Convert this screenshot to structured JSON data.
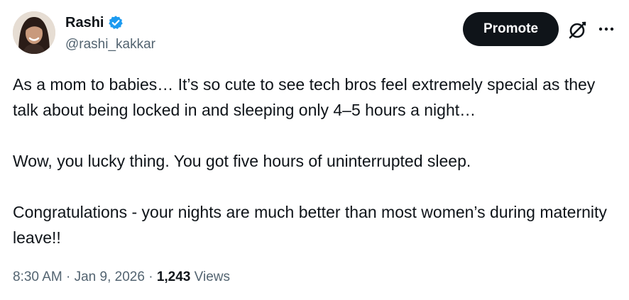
{
  "author": {
    "display_name": "Rashi",
    "handle": "@rashi_kakkar",
    "verified": true
  },
  "actions": {
    "promote_label": "Promote",
    "grok_icon": "grok-icon",
    "more_icon": "more-icon"
  },
  "tweet": {
    "paragraphs": [
      "As a mom to babies… It’s so cute to see tech bros feel extremely special as they talk about being locked in and sleeping only 4–5 hours a night…",
      "Wow, you lucky thing. You got five hours of uninterrupted sleep.",
      "Congratulations - your nights are much better than most women’s during maternity leave!!"
    ],
    "time": "8:30 AM",
    "separator": "·",
    "date": "Jan 9, 2026",
    "views_count": "1,243",
    "views_label": "Views"
  },
  "colors": {
    "text_primary": "#0f1419",
    "text_secondary": "#536471",
    "verified_blue": "#1d9bf0",
    "button_bg": "#0f1419"
  }
}
